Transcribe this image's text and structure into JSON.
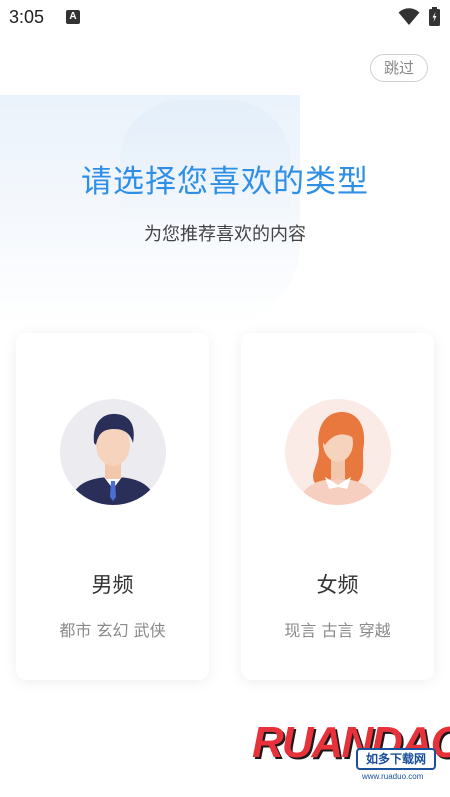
{
  "status_bar": {
    "time": "3:05",
    "notification_badge": "A"
  },
  "header": {
    "skip_label": "跳过"
  },
  "main": {
    "title": "请选择您喜欢的类型",
    "subtitle": "为您推荐喜欢的内容"
  },
  "cards": [
    {
      "title": "男频",
      "tags": "都市 玄幻 武侠",
      "avatar_icon": "male-avatar-icon"
    },
    {
      "title": "女频",
      "tags": "现言 古言 穿越",
      "avatar_icon": "female-avatar-icon"
    }
  ],
  "watermark": {
    "logo_text": "RUANDAO",
    "badge": "如多下载网",
    "url": "www.ruaduo.com"
  },
  "colors": {
    "accent": "#2f8fe6",
    "male_suit": "#2a2f5a",
    "female_hair": "#e8783e"
  }
}
